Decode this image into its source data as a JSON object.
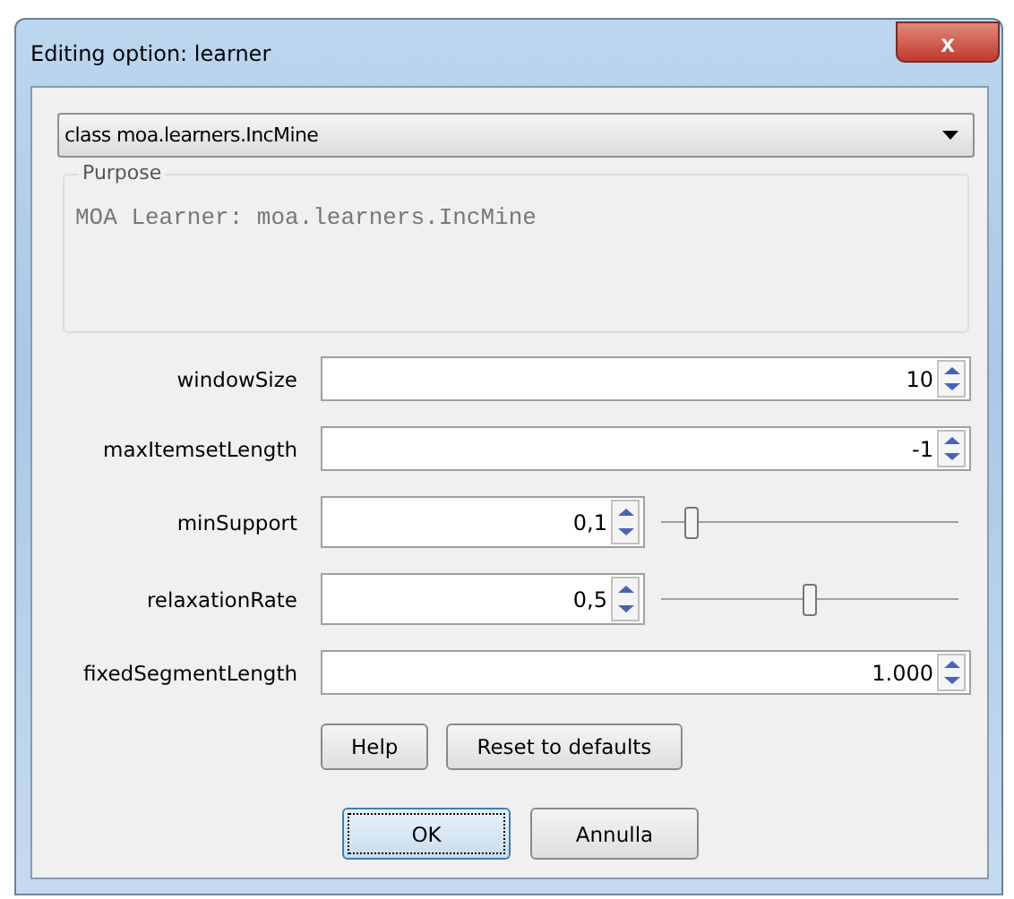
{
  "window": {
    "title": "Editing option: learner",
    "close": "x"
  },
  "class_select": {
    "value": "class moa.learners.IncMine"
  },
  "purpose": {
    "legend": "Purpose",
    "text": "MOA Learner: moa.learners.IncMine"
  },
  "options": [
    {
      "label": "windowSize",
      "value": "10",
      "kind": "spinner"
    },
    {
      "label": "maxItemsetLength",
      "value": "-1",
      "kind": "spinner"
    },
    {
      "label": "minSupport",
      "value": "0,1",
      "kind": "slider",
      "level": 0.1
    },
    {
      "label": "relaxationRate",
      "value": "0,5",
      "kind": "slider",
      "level": 0.5
    },
    {
      "label": "fixedSegmentLength",
      "value": "1.000",
      "kind": "spinner"
    }
  ],
  "option_buttons": [
    "Help",
    "Reset to defaults"
  ],
  "dialog_buttons": [
    {
      "label": "OK",
      "focused": true
    },
    {
      "label": "Annulla",
      "focused": false
    }
  ]
}
